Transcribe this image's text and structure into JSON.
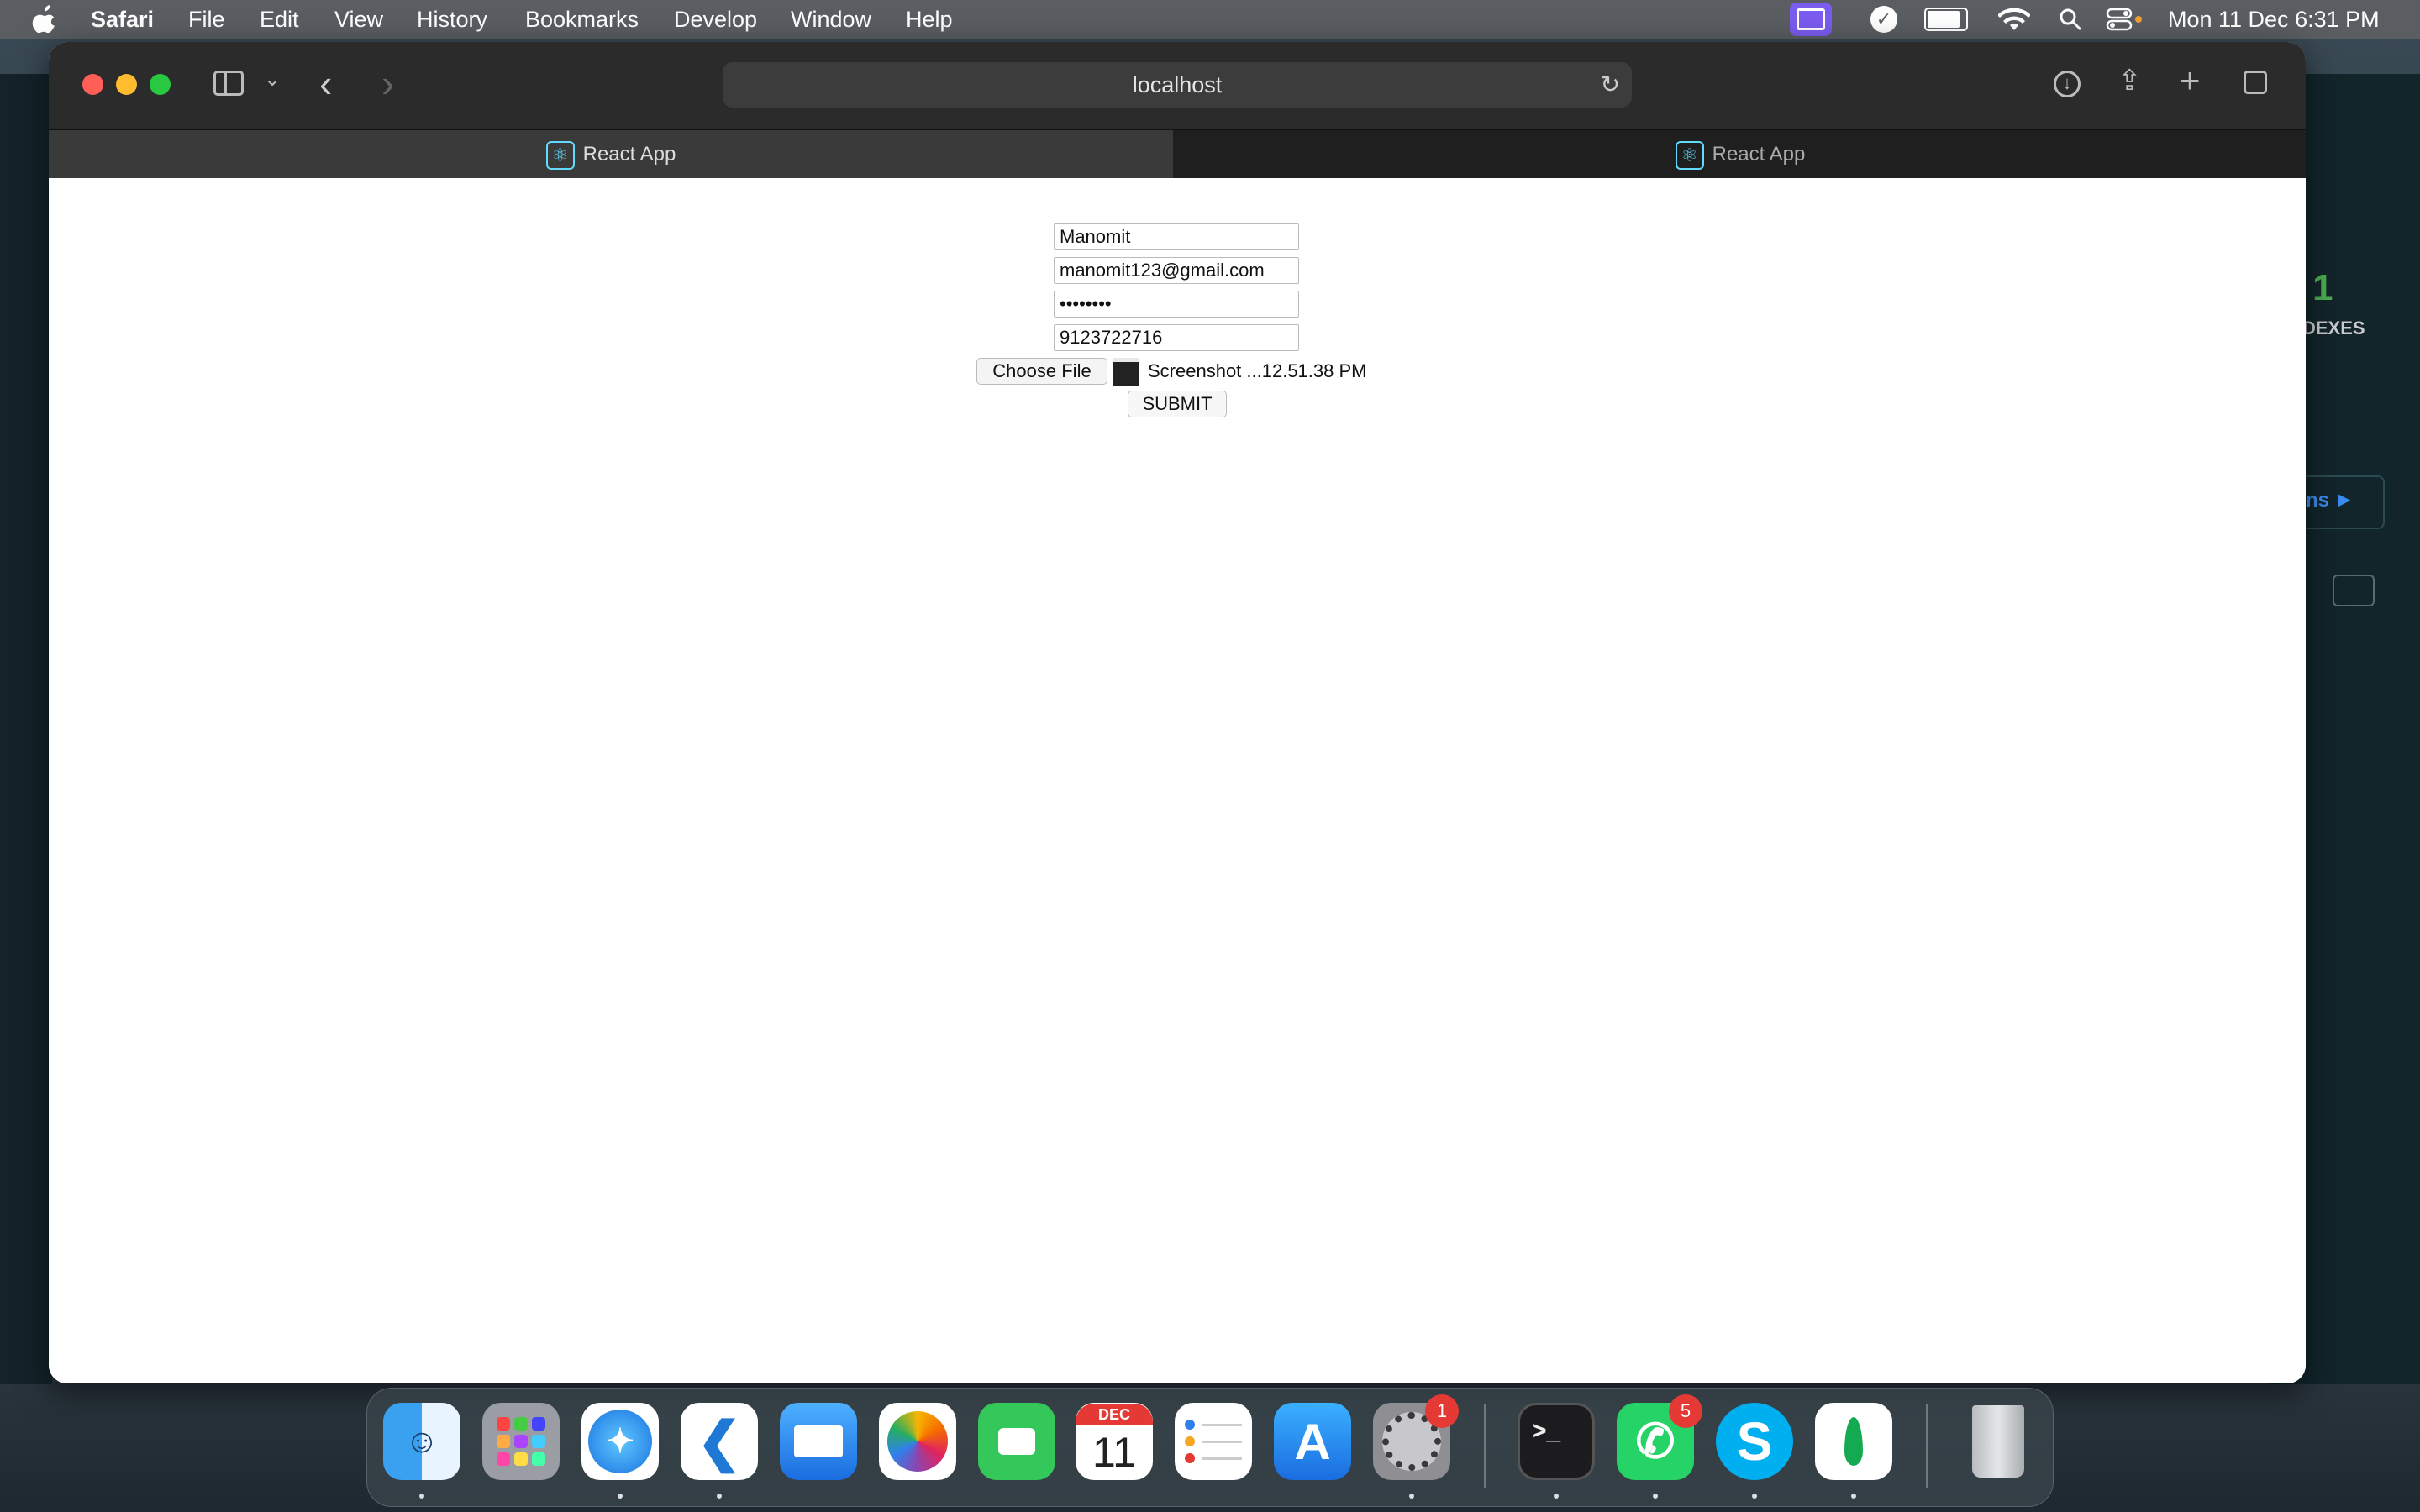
{
  "menubar": {
    "app_name": "Safari",
    "menus": [
      "File",
      "Edit",
      "View",
      "History",
      "Bookmarks",
      "Develop",
      "Window",
      "Help"
    ],
    "datetime": "Mon 11 Dec  6:31 PM"
  },
  "browser": {
    "address": "localhost",
    "tabs": [
      {
        "label": "React App",
        "active": true
      },
      {
        "label": "React App",
        "active": false
      }
    ]
  },
  "form": {
    "name_value": "Manomit",
    "email_value": "manomit123@gmail.com",
    "password_value": "••••••••",
    "phone_value": "9123722716",
    "choose_file_label": "Choose File",
    "file_name": "Screenshot ...12.51.38 PM",
    "submit_label": "SUBMIT"
  },
  "background_app": {
    "count": "1",
    "label_fragment": "DEXES",
    "link_fragment": "ns"
  },
  "dock": {
    "calendar_month": "DEC",
    "calendar_day": "11",
    "badges": {
      "system_settings": "1",
      "whatsapp": "5"
    }
  }
}
